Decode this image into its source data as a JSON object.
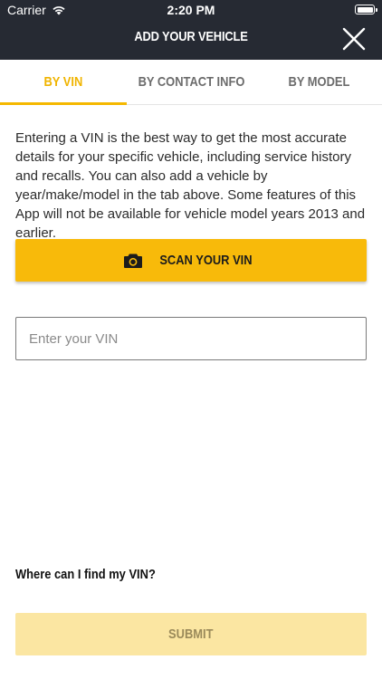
{
  "status_bar": {
    "carrier": "Carrier",
    "time": "2:20 PM"
  },
  "header": {
    "title": "ADD YOUR VEHICLE",
    "background": "#262a33"
  },
  "tabs": [
    {
      "label": "BY VIN",
      "active": true
    },
    {
      "label": "BY CONTACT INFO",
      "active": false
    },
    {
      "label": "BY MODEL",
      "active": false
    }
  ],
  "intro_text": "Entering a VIN is the best way to get the most accurate details for your specific vehicle, including service history and recalls. You can also add a vehicle by year/make/model in the tab above. Some features of this App will not be available for vehicle model years 2013 and earlier.",
  "scan_button": {
    "label": "SCAN YOUR VIN",
    "icon": "camera-icon"
  },
  "vin_field": {
    "placeholder": "Enter your VIN",
    "value": ""
  },
  "help_link": "Where can I find my VIN?",
  "submit_button": {
    "label": "SUBMIT",
    "enabled": false
  },
  "colors": {
    "accent": "#f8ba0a",
    "active_tab": "#f0b400",
    "submit_disabled": "#fbe6a2"
  }
}
